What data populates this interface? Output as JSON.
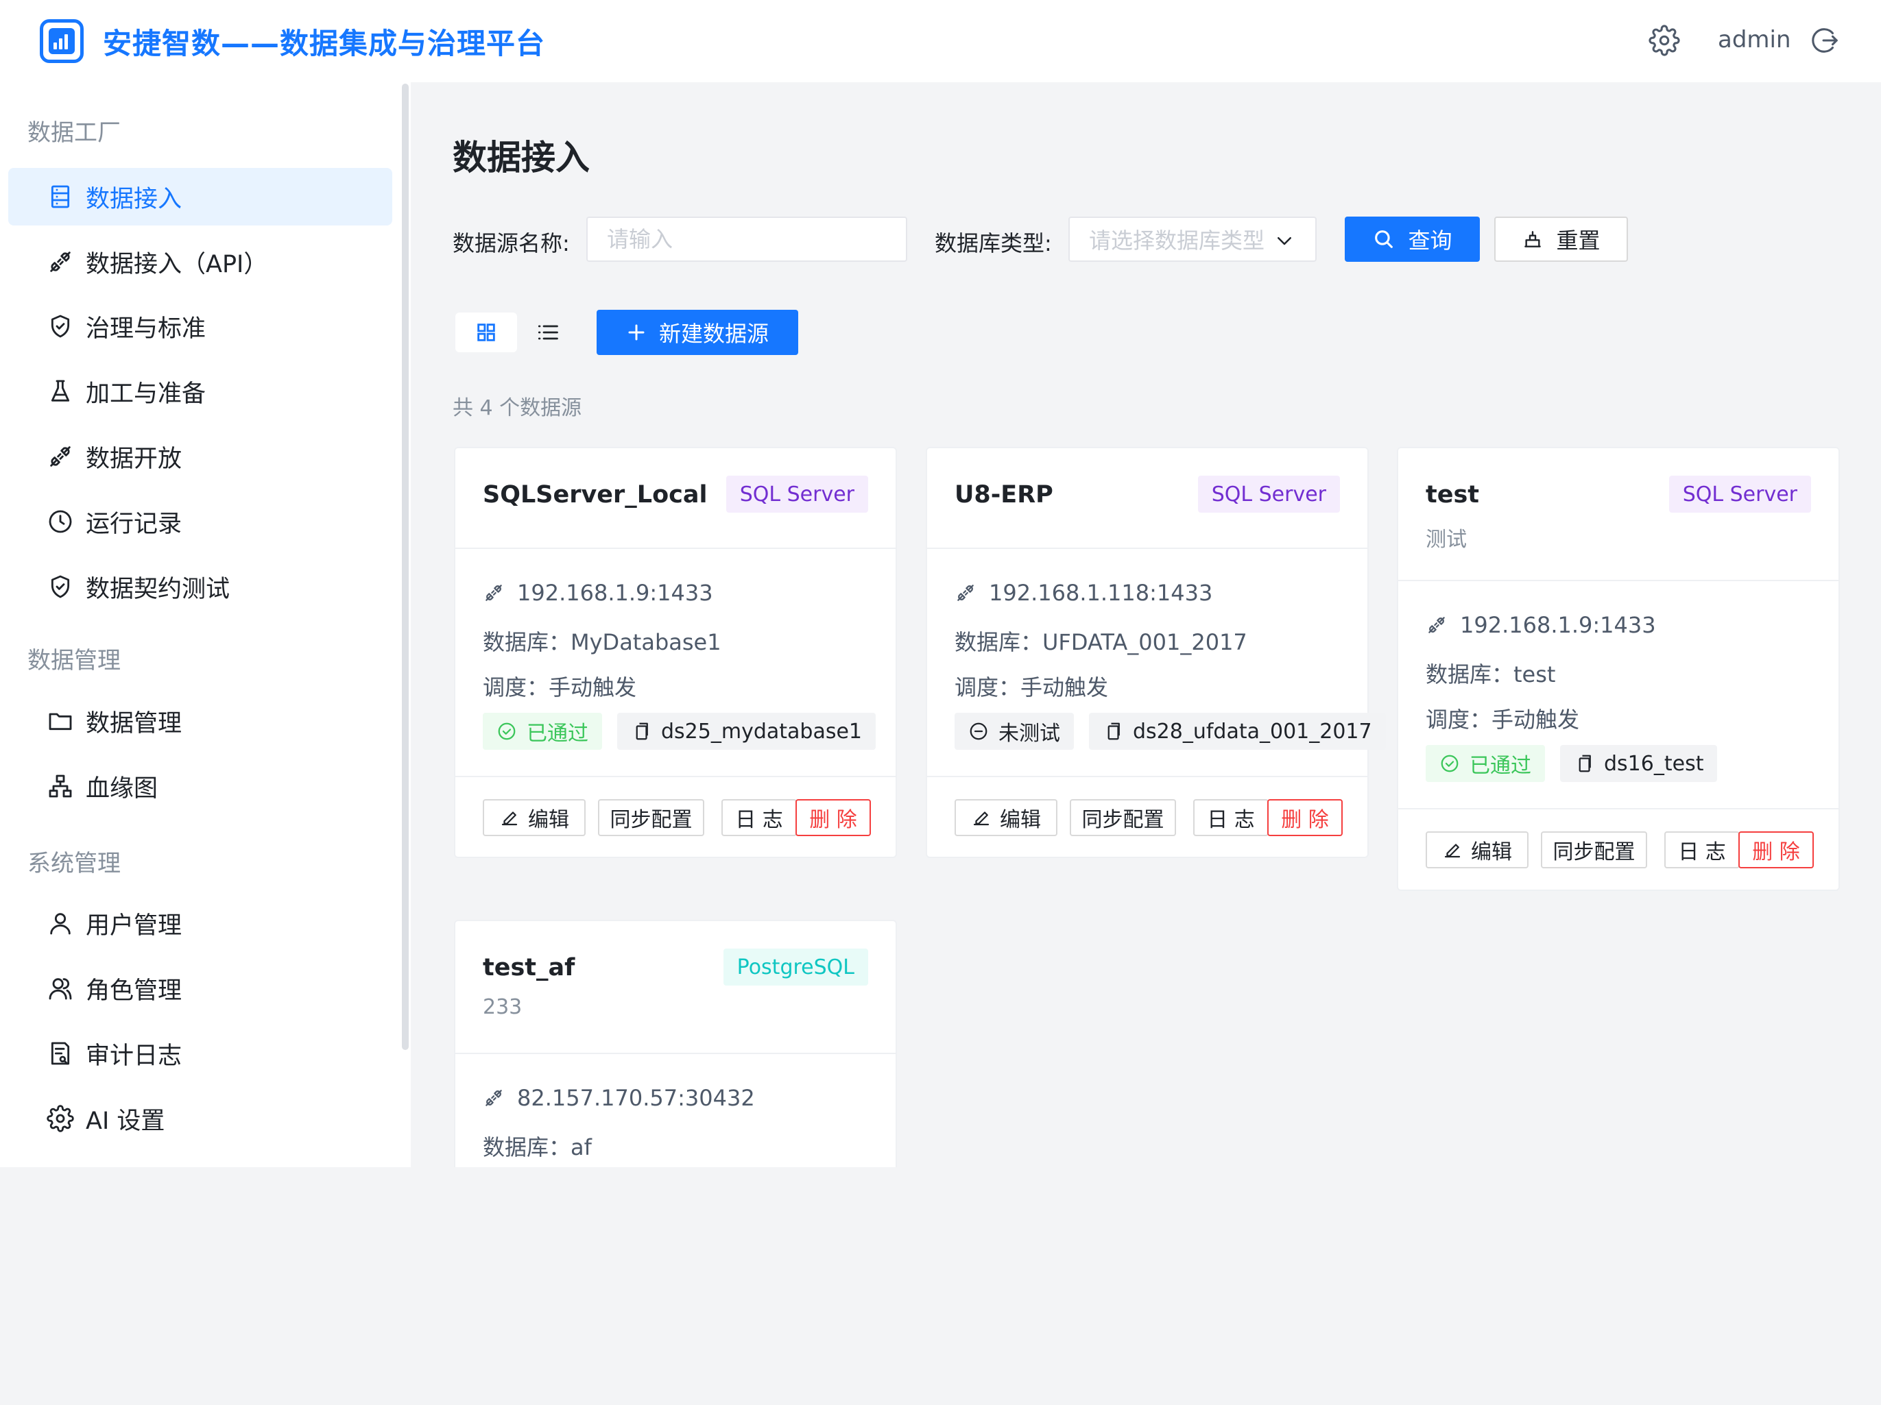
{
  "header": {
    "app_title": "安捷智数——数据集成与治理平台",
    "user": "admin"
  },
  "sidebar": {
    "sections": [
      {
        "title": "数据工厂"
      },
      {
        "title": "数据管理"
      },
      {
        "title": "系统管理"
      }
    ],
    "items": [
      {
        "label": "数据接入",
        "icon": "database-icon",
        "active": true
      },
      {
        "label": "数据接入（API）",
        "icon": "plug-icon"
      },
      {
        "label": "治理与标准",
        "icon": "shield-check-icon"
      },
      {
        "label": "加工与准备",
        "icon": "flask-icon"
      },
      {
        "label": "数据开放",
        "icon": "plug-icon"
      },
      {
        "label": "运行记录",
        "icon": "clock-icon"
      },
      {
        "label": "数据契约测试",
        "icon": "shield-check-icon"
      },
      {
        "label": "数据管理",
        "icon": "folder-icon"
      },
      {
        "label": "血缘图",
        "icon": "sitemap-icon"
      },
      {
        "label": "用户管理",
        "icon": "user-icon"
      },
      {
        "label": "角色管理",
        "icon": "users-icon"
      },
      {
        "label": "审计日志",
        "icon": "audit-icon"
      },
      {
        "label": "AI 设置",
        "icon": "gear-icon"
      }
    ]
  },
  "main": {
    "page_title": "数据接入",
    "filters": {
      "name_label": "数据源名称:",
      "name_placeholder": "请输入",
      "type_label": "数据库类型:",
      "type_placeholder": "请选择数据库类型",
      "query_label": "查询",
      "reset_label": "重置"
    },
    "new_button_label": "新建数据源",
    "count_text": "共 4 个数据源",
    "card_actions": {
      "edit": "编辑",
      "sync": "同步配置",
      "log": "日 志",
      "delete": "删 除"
    },
    "cards": [
      {
        "name": "SQLServer_Local",
        "desc": "",
        "type": "SQL Server",
        "host": "192.168.1.9:1433",
        "database": "数据库：MyDatabase1",
        "schedule": "调度：手动触发",
        "status": "已通过",
        "code": "ds25_mydatabase1"
      },
      {
        "name": "U8-ERP",
        "desc": "",
        "type": "SQL Server",
        "host": "192.168.1.118:1433",
        "database": "数据库：UFDATA_001_2017",
        "schedule": "调度：手动触发",
        "status": "未测试",
        "code": "ds28_ufdata_001_2017"
      },
      {
        "name": "test",
        "desc": "测试",
        "type": "SQL Server",
        "host": "192.168.1.9:1433",
        "database": "数据库：test",
        "schedule": "调度：手动触发",
        "status": "已通过",
        "code": "ds16_test"
      },
      {
        "name": "test_af",
        "desc": "233",
        "type": "PostgreSQL",
        "host": "82.157.170.57:30432",
        "database": "数据库：af"
      }
    ]
  },
  "colors": {
    "primary": "#1677ff",
    "danger": "#f53f3f",
    "success": "#3bc65a",
    "tag_sqlserver_bg": "#f5edfd",
    "tag_sqlserver_fg": "#722ed1",
    "tag_pg_bg": "#e8fbf8",
    "tag_pg_fg": "#0fc6c2"
  }
}
